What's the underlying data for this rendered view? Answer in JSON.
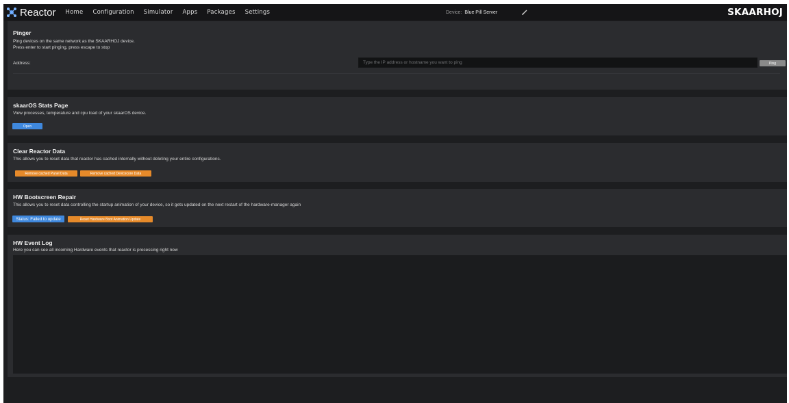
{
  "app": {
    "name": "Reactor",
    "logo": "SKAARHOJ"
  },
  "nav": [
    "Home",
    "Configuration",
    "Simulator",
    "Apps",
    "Packages",
    "Settings"
  ],
  "device": {
    "label": "Device:",
    "value": "Blue Pill Server"
  },
  "pinger": {
    "title": "Pinger",
    "desc1": "Ping devices on the same network as the SKAARHOJ device.",
    "desc2": "Press enter to start pinging, press escape to stop",
    "address_label": "Address:",
    "placeholder": "Type the IP address or hostname you want to ping",
    "button": "Ping"
  },
  "stats": {
    "title": "skaarOS Stats Page",
    "desc": "View processes, temperature and cpu load of your skaarOS device.",
    "button": "Open"
  },
  "clear": {
    "title": "Clear Reactor Data",
    "desc": "This allows you to reset data that reactor has cached internally without deleting your entire configurations.",
    "button_panel": "Remove cached Panel Data",
    "button_devicecore": "Remove cached Devicecore Data"
  },
  "bootscreen": {
    "title": "HW Bootscreen Repair",
    "desc": "This allows you to reset data controlling the startup animation of your device, so it gets updated on the next restart of the hardware-manager again",
    "status": "Status: Failed to update",
    "button": "Reset Hardware Boot Animation Update"
  },
  "eventlog": {
    "title": "HW Event Log",
    "desc": "Here you can see all incoming Hardware events that reactor is processing right now"
  },
  "colors": {
    "accent_blue": "#3f88dd",
    "accent_orange": "#e68a2a",
    "background": "#1d1e20",
    "panel": "#2b2c2f"
  },
  "icons": {
    "brand": "reactor-logo-icon",
    "edit": "pencil-icon"
  }
}
